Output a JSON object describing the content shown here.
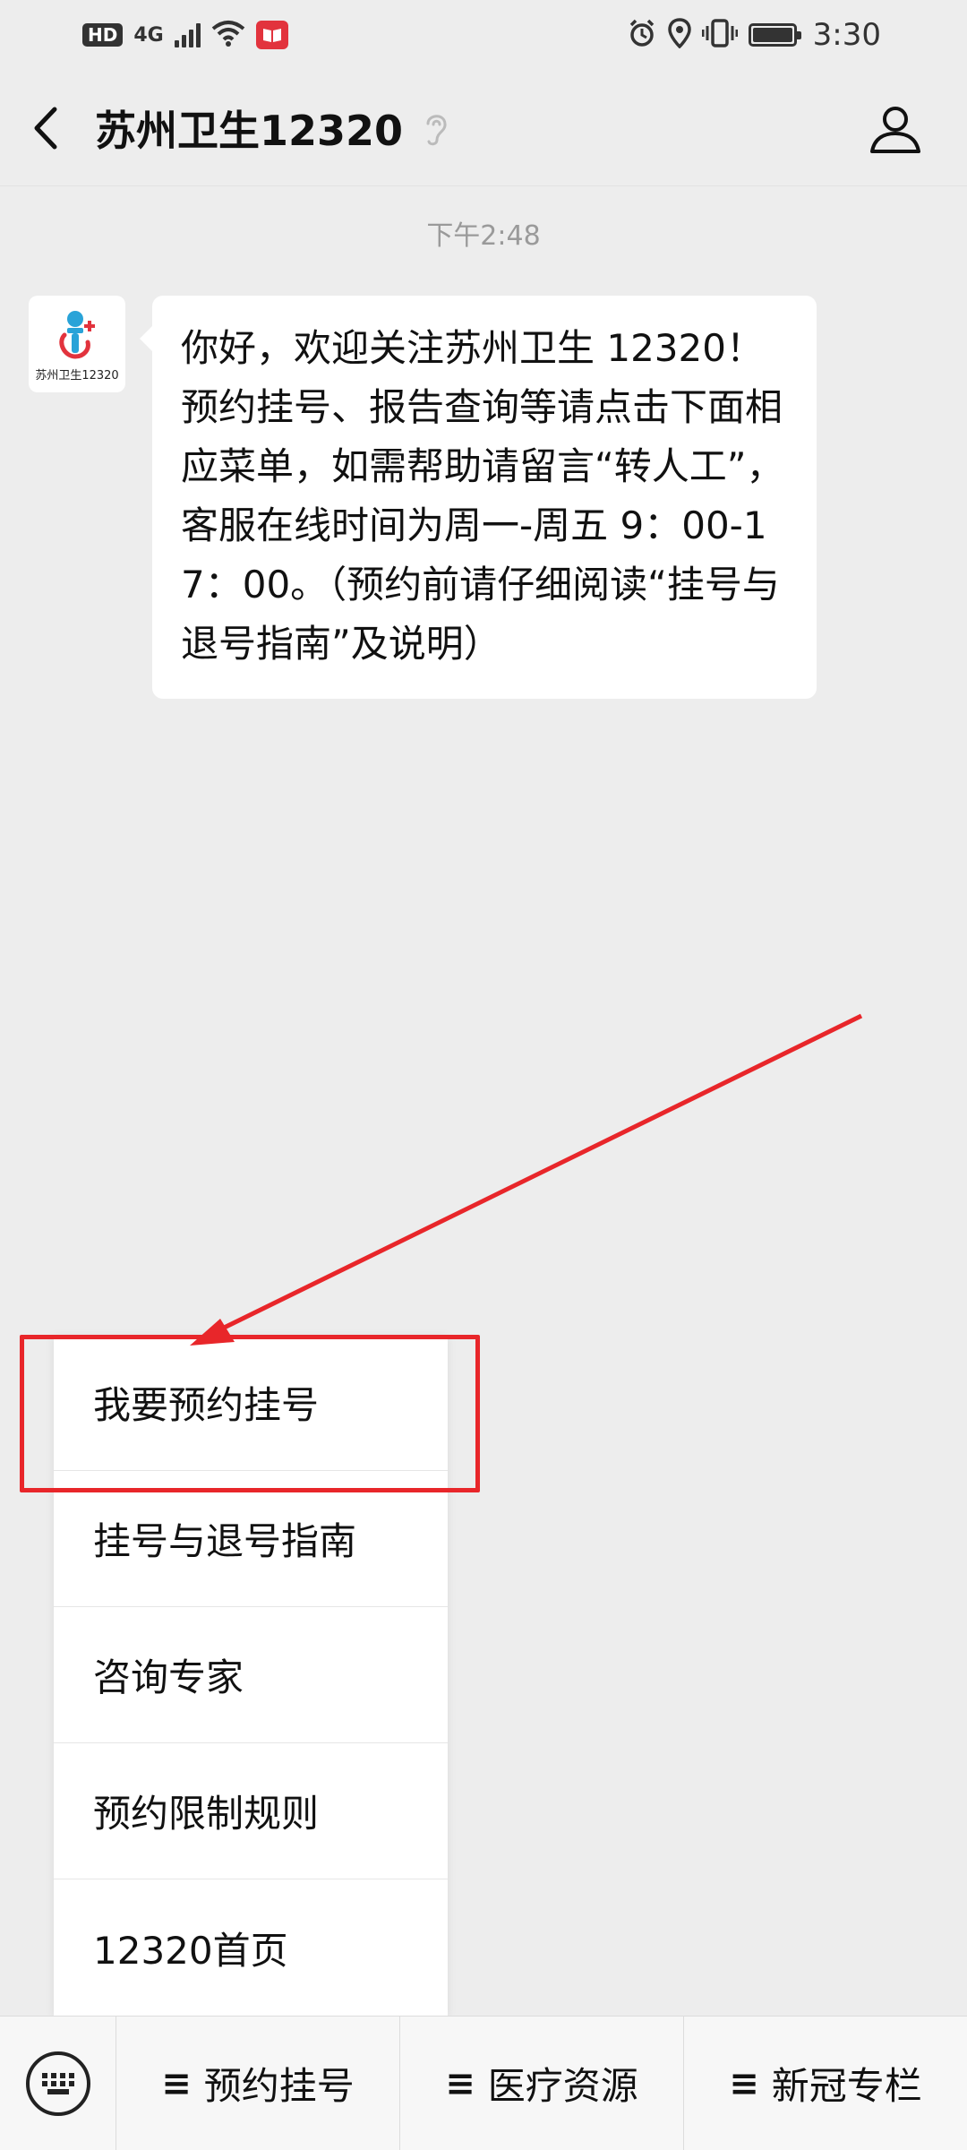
{
  "status_bar": {
    "hd": "HD",
    "network": "4G",
    "time": "3:30"
  },
  "header": {
    "title": "苏州卫生12320"
  },
  "chat": {
    "timestamp": "下午2:48",
    "avatar_label": "苏州卫生12320",
    "message": "你好，欢迎关注苏州卫生 12320！预约挂号、报告查询等请点击下面相应菜单，如需帮助请留言“转人工”，客服在线时间为周一-周五 9：00-17：00。（预约前请仔细阅读“挂号与退号指南”及说明）"
  },
  "popup_menu": {
    "items": [
      {
        "label": "我要预约挂号"
      },
      {
        "label": "挂号与退号指南"
      },
      {
        "label": "咨询专家"
      },
      {
        "label": "预约限制规则"
      },
      {
        "label": "12320首页"
      }
    ]
  },
  "bottom_menu": {
    "tabs": [
      {
        "label": "预约挂号"
      },
      {
        "label": "医疗资源"
      },
      {
        "label": "新冠专栏"
      }
    ]
  },
  "colors": {
    "annotation": "#e8262a",
    "background": "#ededed"
  }
}
